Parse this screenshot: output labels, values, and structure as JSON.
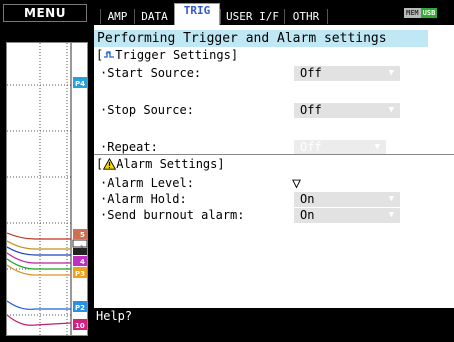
{
  "menu": {
    "label": "MENU"
  },
  "tabs": [
    {
      "label": "AMP",
      "active": false
    },
    {
      "label": "DATA",
      "active": false
    },
    {
      "label": "TRIG",
      "active": true
    },
    {
      "label": "USER I/F",
      "active": false
    },
    {
      "label": "OTHR",
      "active": false
    }
  ],
  "status_badges": {
    "mem": "MEM",
    "usb": "USB"
  },
  "title": "Performing Trigger and Alarm settings",
  "trigger": {
    "heading": "[  Trigger Settings]",
    "heading_prefix": "[",
    "heading_text": "Trigger Settings]",
    "start_source": {
      "label": "·Start Source:",
      "value": "Off"
    },
    "stop_source": {
      "label": "·Stop Source:",
      "value": "Off"
    },
    "repeat": {
      "label": "·Repeat:",
      "value": "Off",
      "disabled": true
    }
  },
  "alarm": {
    "heading_prefix": "[",
    "heading_text": "Alarm Settings]",
    "alarm_level": {
      "label": "·Alarm Level:",
      "value": "▽"
    },
    "alarm_hold": {
      "label": "·Alarm Hold:",
      "value": "On"
    },
    "burnout_alarm": {
      "label": "·Send burnout alarm:",
      "value": "On"
    }
  },
  "help": {
    "text": "Help?"
  },
  "graph_markers": [
    "P4",
    "5",
    "1",
    "4",
    "P3",
    "P2",
    "10"
  ],
  "colors": {
    "title_bg": "#bfe8f4",
    "active_tab_text": "#3355cc",
    "dropdown_bg": "#e2e2e2",
    "warning_yellow": "#f0d800",
    "usb_green": "#33aa33"
  }
}
